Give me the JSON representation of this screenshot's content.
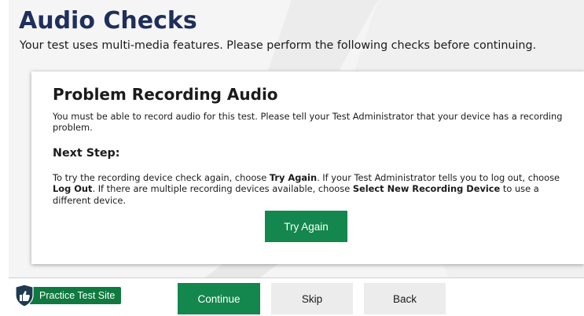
{
  "header": {
    "title": "Audio Checks",
    "subtitle": "Your test uses multi-media features. Please perform the following checks before continuing."
  },
  "card": {
    "title": "Problem Recording Audio",
    "message": "You must be able to record audio for this test. Please tell your Test Administrator that your device has a recording problem.",
    "next_step_heading": "Next Step:",
    "instructions": {
      "part1": "To try the recording device check again, choose ",
      "try_again_bold": "Try Again",
      "part2": ". If your Test Administrator tells you to log out, choose ",
      "log_out_bold": "Log Out",
      "part3": ". If there are multiple recording devices available, choose ",
      "select_device_bold": "Select New Recording Device",
      "part4": " to use a different device."
    },
    "try_again_label": "Try Again"
  },
  "footer": {
    "site_label": "Practice Test Site",
    "site_icon": "shield-thumbs-up-icon",
    "continue_label": "Continue",
    "skip_label": "Skip",
    "back_label": "Back"
  },
  "colors": {
    "primary_green": "#13874d",
    "title_navy": "#1f2f5b",
    "secondary_button": "#ececec",
    "badge_shield": "#1f3a50"
  }
}
